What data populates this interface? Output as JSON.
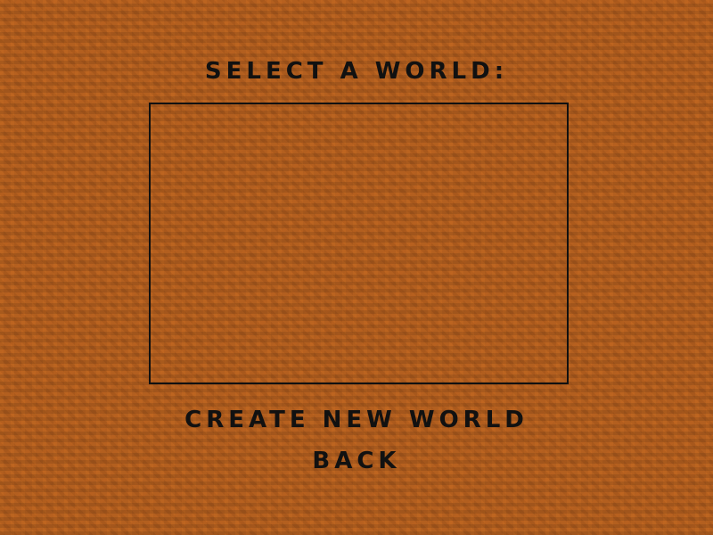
{
  "screen": {
    "title": "SELECT A WORLD:",
    "worlds": [],
    "buttons": {
      "create_new_world": "CREATE NEW WORLD",
      "back": "BACK"
    }
  },
  "colors": {
    "background": "#b35f1f",
    "text": "#111111",
    "list_border": "#111111"
  }
}
